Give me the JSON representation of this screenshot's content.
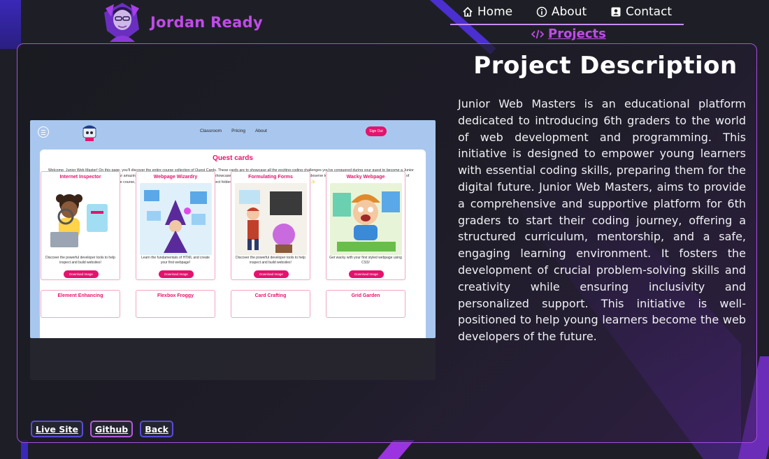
{
  "brand": {
    "name": "Jordan Ready",
    "avatar_icon": "avatar-icon"
  },
  "nav": {
    "items": [
      {
        "label": "Home",
        "icon": "home-icon"
      },
      {
        "label": "About",
        "icon": "info-icon"
      },
      {
        "label": "Contact",
        "icon": "contact-card-icon"
      }
    ],
    "active": {
      "label": "Projects",
      "icon": "code-icon"
    }
  },
  "preview": {
    "links": [
      "Classroom",
      "Pricing",
      "About"
    ],
    "signout_label": "Sign Out",
    "title": "Quest cards",
    "intro": "Welcome, Junior Web Master! On this page, you'll discover the entire course collection of Quest Cards. These cards are to showcase all the exciting coding challenges you've conquered during your quest to become a Junior Web Master! Here, you can not only see your amazing Quest Cards but also download the images to showcase in your very own coding projects! Your victories deserve to shine, and these Quest Cards are your badges of honor. Once you complete a quest during the course, go ahead and download the image into your project folder to use when creating your own course cards! 💻✨",
    "download_label": "Download Image",
    "cards": [
      {
        "title": "Internet Inspector",
        "desc": "Discover the powerful developer tools to help inspect and build websites!"
      },
      {
        "title": "Webpage Wizardry",
        "desc": "Learn the fundamentals of HTML and create your first webpage!"
      },
      {
        "title": "Formulating Forms",
        "desc": "Discover the powerful developer tools to help inspect and build websites!"
      },
      {
        "title": "Wacky Webpage",
        "desc": "Get wacky with your first styled webpage using CSS!"
      },
      {
        "title": "Element Enhancing"
      },
      {
        "title": "Flexbox Froggy"
      },
      {
        "title": "Card Crafting"
      },
      {
        "title": "Grid Garden"
      }
    ]
  },
  "description": {
    "title": "Project Description",
    "text": "Junior Web Masters is an educational platform dedicated to introducing 6th graders to the world of web development and programming. This initiative is designed to empower young learners with essential coding skills, preparing them for the digital future. Junior Web Masters, aims to provide a comprehensive and supportive platform for 6th graders to start their coding journey, offering a structured curriculum, mentorship, and a safe, engaging learning environment. It fosters the development of crucial problem-solving skills and creativity while ensuring inclusivity and personalized support. This initiative is well-positioned to help young learners become the web developers of the future."
  },
  "buttons": {
    "live": "Live Site",
    "github": "Github",
    "back": "Back"
  },
  "colors": {
    "accent": "#c04be8",
    "border": "#a34fe0",
    "pink": "#e4136d",
    "preview_bg": "#a9c7ee"
  }
}
